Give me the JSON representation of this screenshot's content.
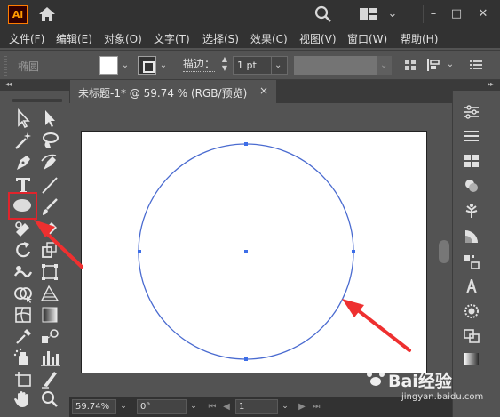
{
  "app": {
    "logo_text": "Ai",
    "accent_color": "#ff9a00"
  },
  "titlebar": {
    "icons": [
      "home-icon",
      "search-icon",
      "arrange-documents-icon"
    ],
    "window_buttons": [
      "minimize",
      "maximize",
      "close"
    ]
  },
  "menu": {
    "items": [
      "文件(F)",
      "编辑(E)",
      "对象(O)",
      "文字(T)",
      "选择(S)",
      "效果(C)",
      "视图(V)",
      "窗口(W)",
      "帮助(H)"
    ]
  },
  "controlbar": {
    "tool_name": "椭圆",
    "fill_color": "#ffffff",
    "stroke_label": "描边：",
    "stroke_weight": "1 pt"
  },
  "document": {
    "tab_title": "未标题-1* @ 59.74 % (RGB/预览)",
    "close_glyph": "×"
  },
  "canvas": {
    "shape": "ellipse",
    "stroke_color": "#4a6bd0",
    "anchor_color": "#3d6ee8",
    "annotation_color": "#ee3030"
  },
  "statusbar": {
    "zoom": "59.74%",
    "rotation": "0°",
    "page": "1"
  },
  "watermark": {
    "main": "Bai经验",
    "sub": "jingyan.baidu.com"
  },
  "tools": [
    "selection-tool",
    "direct-selection-tool",
    "magic-wand-tool",
    "lasso-tool",
    "pen-tool",
    "curvature-tool",
    "type-tool",
    "line-segment-tool",
    "ellipse-tool",
    "paintbrush-tool",
    "shaper-tool",
    "eraser-tool",
    "rotate-tool",
    "scale-tool",
    "warp-tool",
    "free-transform-tool",
    "shape-builder-tool",
    "perspective-grid-tool",
    "mesh-tool",
    "gradient-tool",
    "eyedropper-tool",
    "blend-tool",
    "symbol-sprayer-tool",
    "column-graph-tool",
    "artboard-tool",
    "slice-tool",
    "hand-tool",
    "zoom-tool"
  ],
  "right_panel": [
    "properties-icon",
    "layers-icon",
    "swatches-icon",
    "color-icon",
    "symbols-icon",
    "color-guide-icon",
    "transform-icon",
    "character-icon",
    "appearance-icon",
    "pathfinder-icon",
    "gradient-icon"
  ]
}
